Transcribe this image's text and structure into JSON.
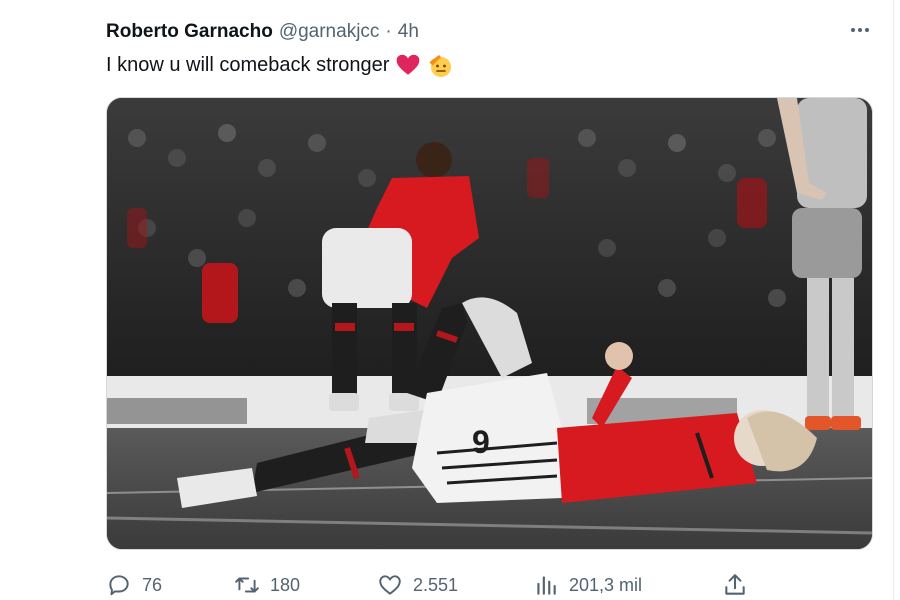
{
  "tweet": {
    "author_name": "Roberto Garnacho",
    "author_handle": "@garnakjcc",
    "separator": "·",
    "time": "4h",
    "text": "I know u will comeback stronger"
  },
  "media": {
    "jersey_number": "9"
  },
  "actions": {
    "replies": "76",
    "retweets": "180",
    "likes": "2.551",
    "views": "201,3 mil"
  },
  "icons": {
    "more": "more-horizontal-icon",
    "reply": "reply-icon",
    "retweet": "retweet-icon",
    "like": "heart-outline-icon",
    "views": "views-chart-icon",
    "share": "share-icon",
    "emoji_1": "red-heart-icon",
    "emoji_2": "saluting-face-icon"
  },
  "colors": {
    "text_primary": "#0f1419",
    "text_secondary": "#536471",
    "heart_red": "#e0245e",
    "jersey_red": "#d61a1f"
  }
}
